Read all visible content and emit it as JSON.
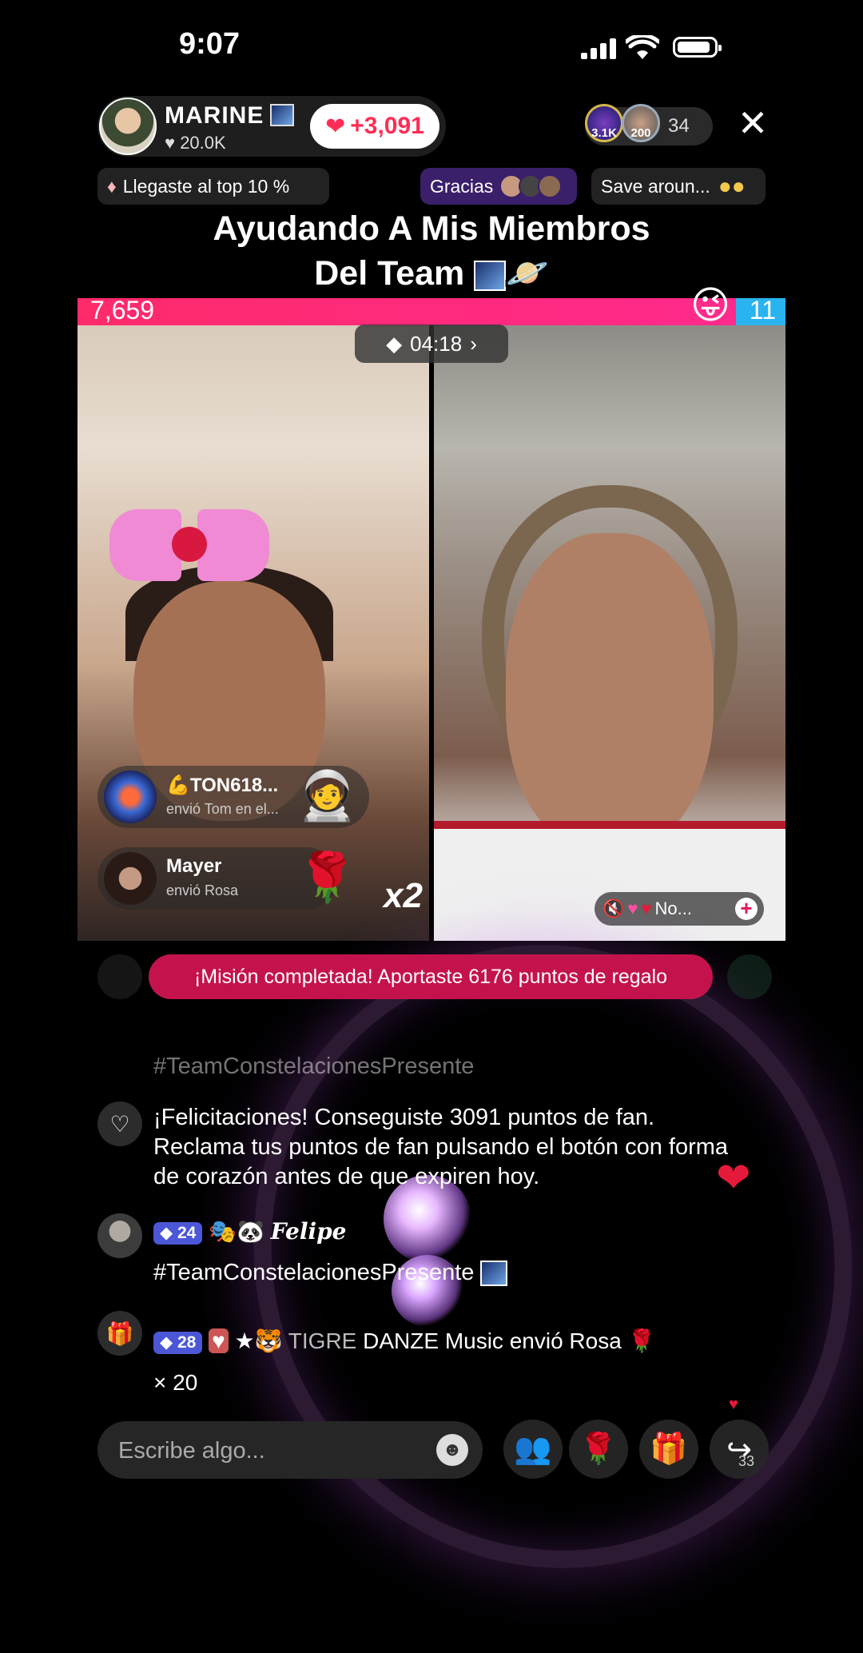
{
  "status": {
    "time": "9:07"
  },
  "host": {
    "name": "MARINE",
    "likes": "20.0K",
    "hearts": "+3,091"
  },
  "viewers": {
    "count": "34",
    "top1": "3.1K",
    "top2": "200"
  },
  "chips": {
    "top10": "Llegaste al top 10 %",
    "gracias": "Gracias",
    "save": "Save aroun..."
  },
  "title": {
    "line1": "Ayudando A Mis Miembros",
    "line2": "Del Team"
  },
  "battle": {
    "left_score": "7,659",
    "right_score": "11",
    "timer": "04:18"
  },
  "gifts": [
    {
      "name": "TON618...",
      "message": "envió Tom en el...",
      "icon": "astronaut-gift-icon"
    },
    {
      "name": "Mayer",
      "message": "envió Rosa",
      "icon": "rose-gift-icon"
    }
  ],
  "combo": "x2",
  "guest_label": "No...",
  "mission_text": "¡Misión completada! Aportaste 6176 puntos de regalo",
  "comments": {
    "faded_tag": "#TeamConstelacionesPresente",
    "fan_message": "¡Felicitaciones! Conseguiste 3091 puntos de fan. Reclama tus puntos de fan pulsando el botón con forma de corazón antes de que expiren hoy.",
    "felipe": {
      "level": "24",
      "name": "Felipe",
      "message": "#TeamConstelacionesPresente"
    },
    "tigre": {
      "level": "28",
      "name": "TIGRE",
      "text": "DANZE Music envió Rosa",
      "multiplier": "× 20"
    }
  },
  "input": {
    "placeholder": "Escribe algo..."
  },
  "share_count": "33",
  "colors": {
    "accent": "#ff2a6a",
    "blue": "#2ab4ef",
    "mission": "#c4134c"
  }
}
